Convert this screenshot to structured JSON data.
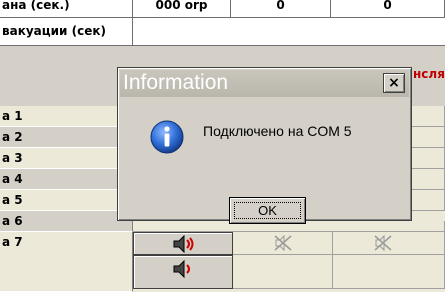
{
  "table": {
    "header_row1_label": "ана (сек.)",
    "header_row1_val1": "000 orp",
    "header_row1_val2": "0",
    "header_row1_val3": "0",
    "header_row2_label": "вакуации (сек)",
    "column_header_partial": "нсля",
    "rows": [
      "а 1",
      "а 2",
      "а 3",
      "а 4",
      "а 5",
      "а 6",
      "а 7"
    ]
  },
  "dialog": {
    "title": "Information",
    "close_label": "×",
    "message": "Подключено на COM 5",
    "ok_label": "OK"
  },
  "icons": {
    "info": "info-icon",
    "speaker": "speaker-icon",
    "muted": "speaker-muted-icon"
  },
  "colors": {
    "accent_red": "#c00000",
    "info_blue": "#1f5fbf"
  }
}
